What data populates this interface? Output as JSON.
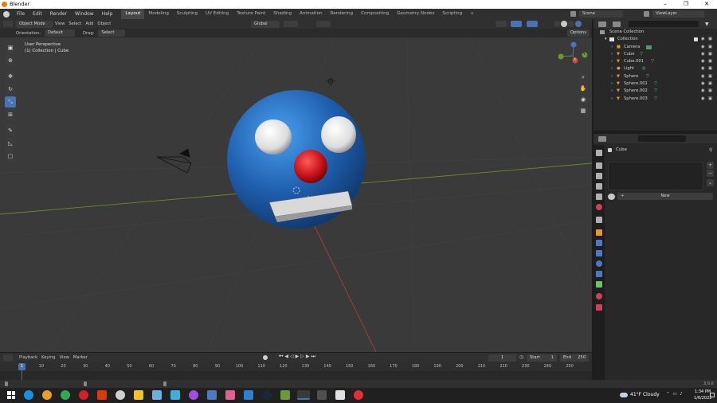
{
  "window": {
    "title": "Blender",
    "min": "–",
    "max": "❐",
    "close": "✕"
  },
  "menu": [
    "File",
    "Edit",
    "Render",
    "Window",
    "Help"
  ],
  "workspaces": [
    "Layout",
    "Modeling",
    "Sculpting",
    "UV Editing",
    "Texture Paint",
    "Shading",
    "Animation",
    "Rendering",
    "Compositing",
    "Geometry Nodes",
    "Scripting",
    "+"
  ],
  "scene": {
    "scene_label": "Scene",
    "viewlayer_label": "ViewLayer"
  },
  "viewport_header": {
    "mode": "Object Mode",
    "view": "View",
    "select": "Select",
    "add": "Add",
    "object": "Object",
    "transform": "Global",
    "orientation_label": "Orientation:",
    "orientation_value": "Default",
    "drag_label": "Drag:",
    "drag_value": "Select Box",
    "options": "Options"
  },
  "viewport": {
    "perspective": "User Perspective",
    "collection": "(1) Collection | Cube",
    "gizmo_y": "Y",
    "gizmo_x": "X"
  },
  "outliner": {
    "search_placeholder": "",
    "root": "Scene Collection",
    "collection": "Collection",
    "items": [
      "Camera",
      "Cube",
      "Cube.001",
      "Light",
      "Sphere",
      "Sphere.001",
      "Sphere.002",
      "Sphere.003"
    ]
  },
  "properties": {
    "object_name": "Cube",
    "new_button": "New"
  },
  "timeline": {
    "playback": "Playback",
    "keying": "Keying",
    "view": "View",
    "marker": "Marker",
    "current_frame": "1",
    "start_label": "Start",
    "start_value": "1",
    "end_label": "End",
    "end_value": "250",
    "ticks": [
      "1",
      "10",
      "20",
      "30",
      "40",
      "50",
      "60",
      "70",
      "80",
      "90",
      "100",
      "110",
      "120",
      "130",
      "140",
      "150",
      "160",
      "170",
      "180",
      "190",
      "200",
      "210",
      "220",
      "230",
      "240",
      "250"
    ]
  },
  "status": {
    "version": "3.0.0"
  },
  "taskbar": {
    "weather": "41°F Cloudy",
    "time": "1:34 PM",
    "date": "1/6/2022"
  },
  "colors": {
    "accent": "#4772b3",
    "sphere_blue": "#1f5fae",
    "nose_red": "#c8141a"
  }
}
